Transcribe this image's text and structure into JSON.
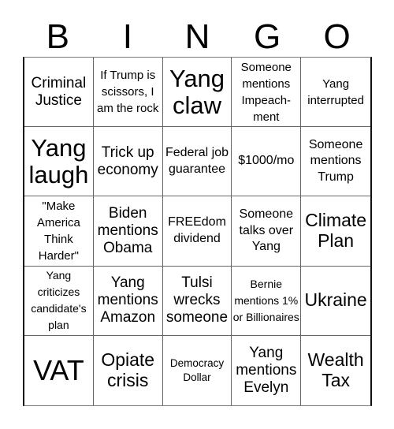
{
  "header": {
    "letters": [
      "B",
      "I",
      "N",
      "G",
      "O"
    ]
  },
  "board": {
    "rows": [
      [
        "Criminal Justice",
        "If Trump is scissors, I am the rock",
        "Yang claw",
        "Someone mentions Impeach- ment",
        "Yang interrupted"
      ],
      [
        "Yang laugh",
        "Trick up economy",
        "Federal job guarantee",
        "$1000/mo",
        "Someone mentions Trump"
      ],
      [
        "\"Make America Think Harder\"",
        "Biden mentions Obama",
        "FREEdom dividend",
        "Someone talks over Yang",
        "Climate Plan"
      ],
      [
        "Yang criticizes candidate's plan",
        "Yang mentions Amazon",
        "Tulsi wrecks someone",
        "Bernie mentions 1% or Billionaires",
        "Ukraine"
      ],
      [
        "VAT",
        "Opiate crisis",
        "Democracy Dollar",
        "Yang mentions Evelyn",
        "Wealth Tax"
      ]
    ]
  }
}
